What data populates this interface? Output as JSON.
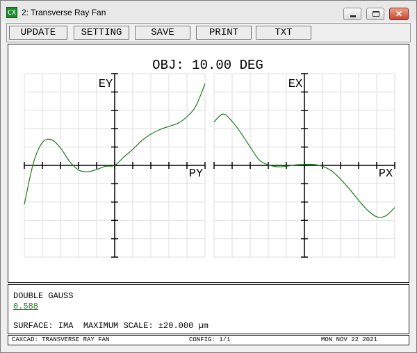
{
  "window": {
    "app_icon_text": "CX",
    "title": "2: Transverse Ray Fan"
  },
  "toolbar": {
    "buttons": [
      {
        "label": "UPDATE"
      },
      {
        "label": "SETTING"
      },
      {
        "label": "SAVE"
      },
      {
        "label": "PRINT"
      },
      {
        "label": "TXT"
      }
    ]
  },
  "plot": {
    "title": "OBJ: 10.00 DEG",
    "left_y_label": "EY",
    "left_x_label": "PY",
    "right_y_label": "EX",
    "right_x_label": "PX",
    "curve_color": "#1a7a1a",
    "grid_color": "#dcdcdc"
  },
  "chart_data": [
    {
      "type": "line",
      "title": "",
      "xlabel": "PY",
      "ylabel": "EY",
      "xlim": [
        -1,
        1
      ],
      "ylim": [
        -20,
        20
      ],
      "series": [
        {
          "x": [
            -1.0,
            -0.9,
            -0.8,
            -0.7,
            -0.6,
            -0.5,
            -0.4,
            -0.3,
            -0.2,
            -0.1,
            0.0,
            0.1,
            0.2,
            0.3,
            0.4,
            0.5,
            0.6,
            0.7,
            0.8,
            0.9,
            1.0
          ],
          "values": [
            -8.5,
            0.5,
            5.0,
            5.6,
            3.8,
            0.9,
            -1.0,
            -1.4,
            -0.9,
            -0.2,
            0.0,
            1.8,
            3.5,
            5.4,
            6.8,
            7.8,
            8.5,
            9.2,
            10.6,
            13.0,
            17.8
          ]
        }
      ]
    },
    {
      "type": "line",
      "title": "",
      "xlabel": "PX",
      "ylabel": "EX",
      "xlim": [
        -1,
        1
      ],
      "ylim": [
        -20,
        20
      ],
      "series": [
        {
          "x": [
            -1.0,
            -0.9,
            -0.8,
            -0.7,
            -0.6,
            -0.5,
            -0.4,
            -0.3,
            -0.2,
            -0.1,
            0.0,
            0.1,
            0.2,
            0.3,
            0.4,
            0.5,
            0.6,
            0.7,
            0.8,
            0.9,
            1.0
          ],
          "values": [
            9.5,
            11.2,
            9.6,
            7.0,
            4.0,
            1.2,
            0.1,
            -0.3,
            -0.2,
            0.1,
            0.2,
            0.2,
            -0.2,
            -1.2,
            -3.0,
            -5.2,
            -7.6,
            -9.8,
            -11.2,
            -11.0,
            -9.2
          ]
        }
      ]
    }
  ],
  "info": {
    "lens_name": "DOUBLE GAUSS",
    "value_link": "0.588",
    "surface_label": "SURFACE:",
    "surface_value": "IMA",
    "scale_label": "MAXIMUM SCALE:",
    "scale_value": "±20.000 µm"
  },
  "status": {
    "left": "CAXCAD: TRANSVERSE RAY FAN",
    "center": "CONFIG: 1/1",
    "right": "MON NOV 22 2021"
  }
}
